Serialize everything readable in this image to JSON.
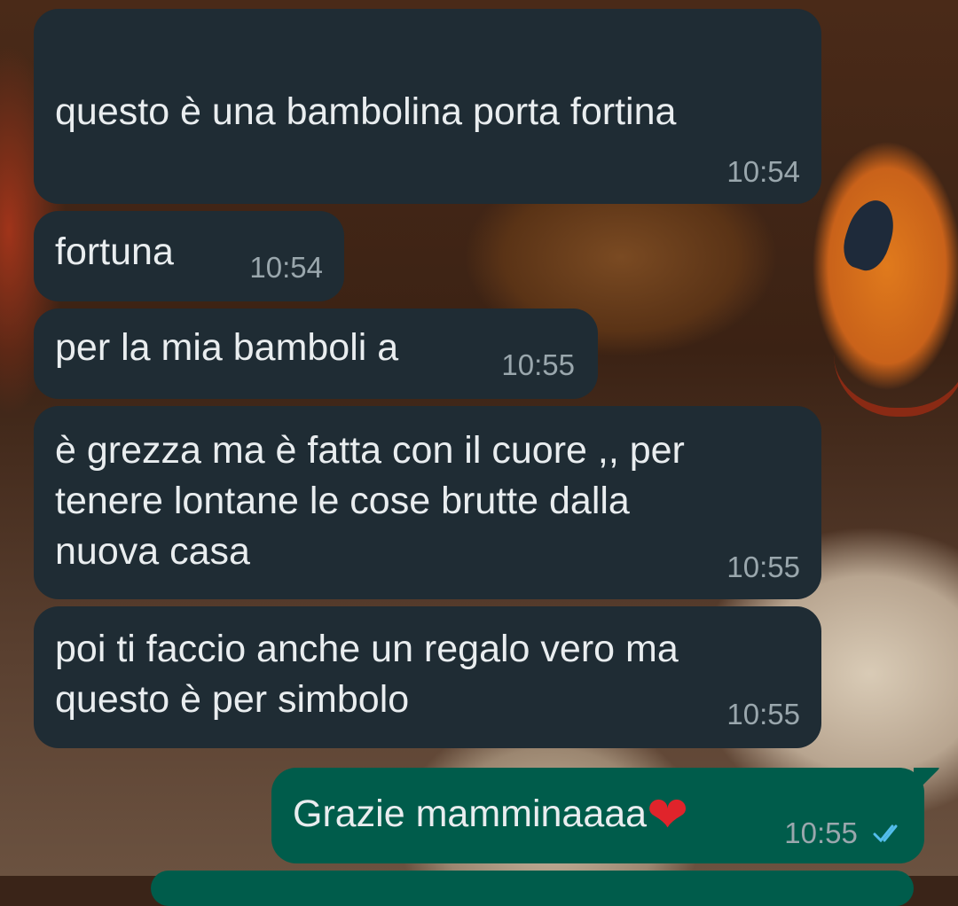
{
  "messages": [
    {
      "direction": "incoming",
      "text": "questo è una bambolina porta fortina",
      "time": "10:54"
    },
    {
      "direction": "incoming",
      "text": "fortuna",
      "time": "10:54"
    },
    {
      "direction": "incoming",
      "text": "per la mia bamboli a",
      "time": "10:55"
    },
    {
      "direction": "incoming",
      "lines": [
        "è grezza ma è fatta con il cuore ,, per",
        "tenere lontane le cose brutte dalla",
        "nuova casa"
      ],
      "time": "10:55"
    },
    {
      "direction": "incoming",
      "lines": [
        "poi ti faccio anche un regalo vero ma",
        "questo è per simbolo"
      ],
      "time": "10:55"
    },
    {
      "direction": "outgoing",
      "text": "Grazie mamminaaaa",
      "emoji": "❤",
      "time": "10:55",
      "status": "read"
    }
  ],
  "colors": {
    "incoming_bubble": "#1f2c34",
    "outgoing_bubble": "#005c4b",
    "text": "#e9edef",
    "timestamp": "#9aa7ad",
    "read_ticks": "#53bdeb"
  },
  "icons": {
    "read_receipt": "double-check-icon",
    "emoji": "red-heart-emoji"
  }
}
